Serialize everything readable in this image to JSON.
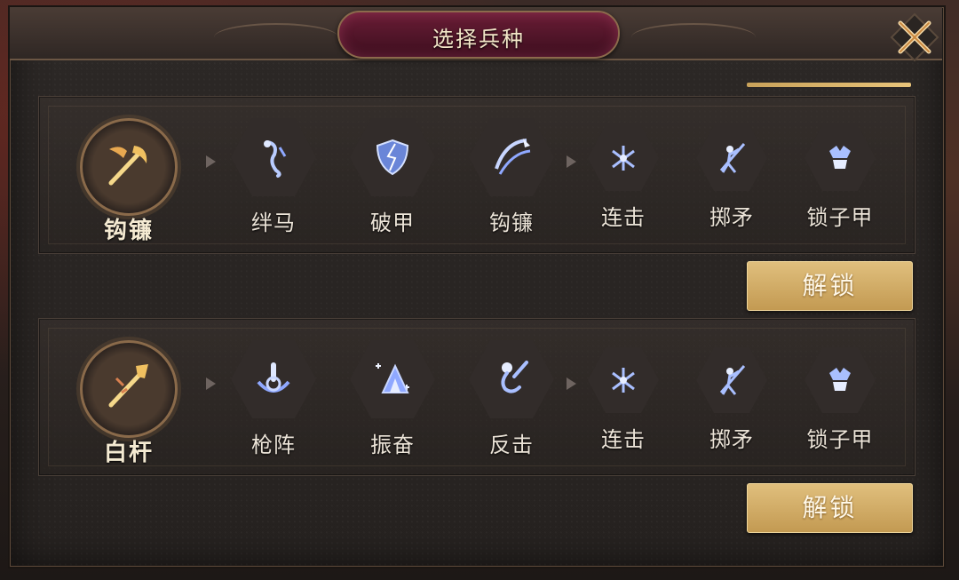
{
  "dialog": {
    "title": "选择兵种"
  },
  "units": [
    {
      "name": "钩镰",
      "icon": "hook-sickle-icon",
      "skills": [
        "绊马",
        "破甲",
        "钩镰",
        "连击",
        "掷矛",
        "锁子甲"
      ],
      "unlock_label": "解锁"
    },
    {
      "name": "白杆",
      "icon": "spear-icon",
      "skills": [
        "枪阵",
        "振奋",
        "反击",
        "连击",
        "掷矛",
        "锁子甲"
      ],
      "unlock_label": "解锁"
    }
  ],
  "colors": {
    "accent_gold": "#c9a25a",
    "title_plate": "#5a1630",
    "skill_glow": "#8fb0ff"
  }
}
